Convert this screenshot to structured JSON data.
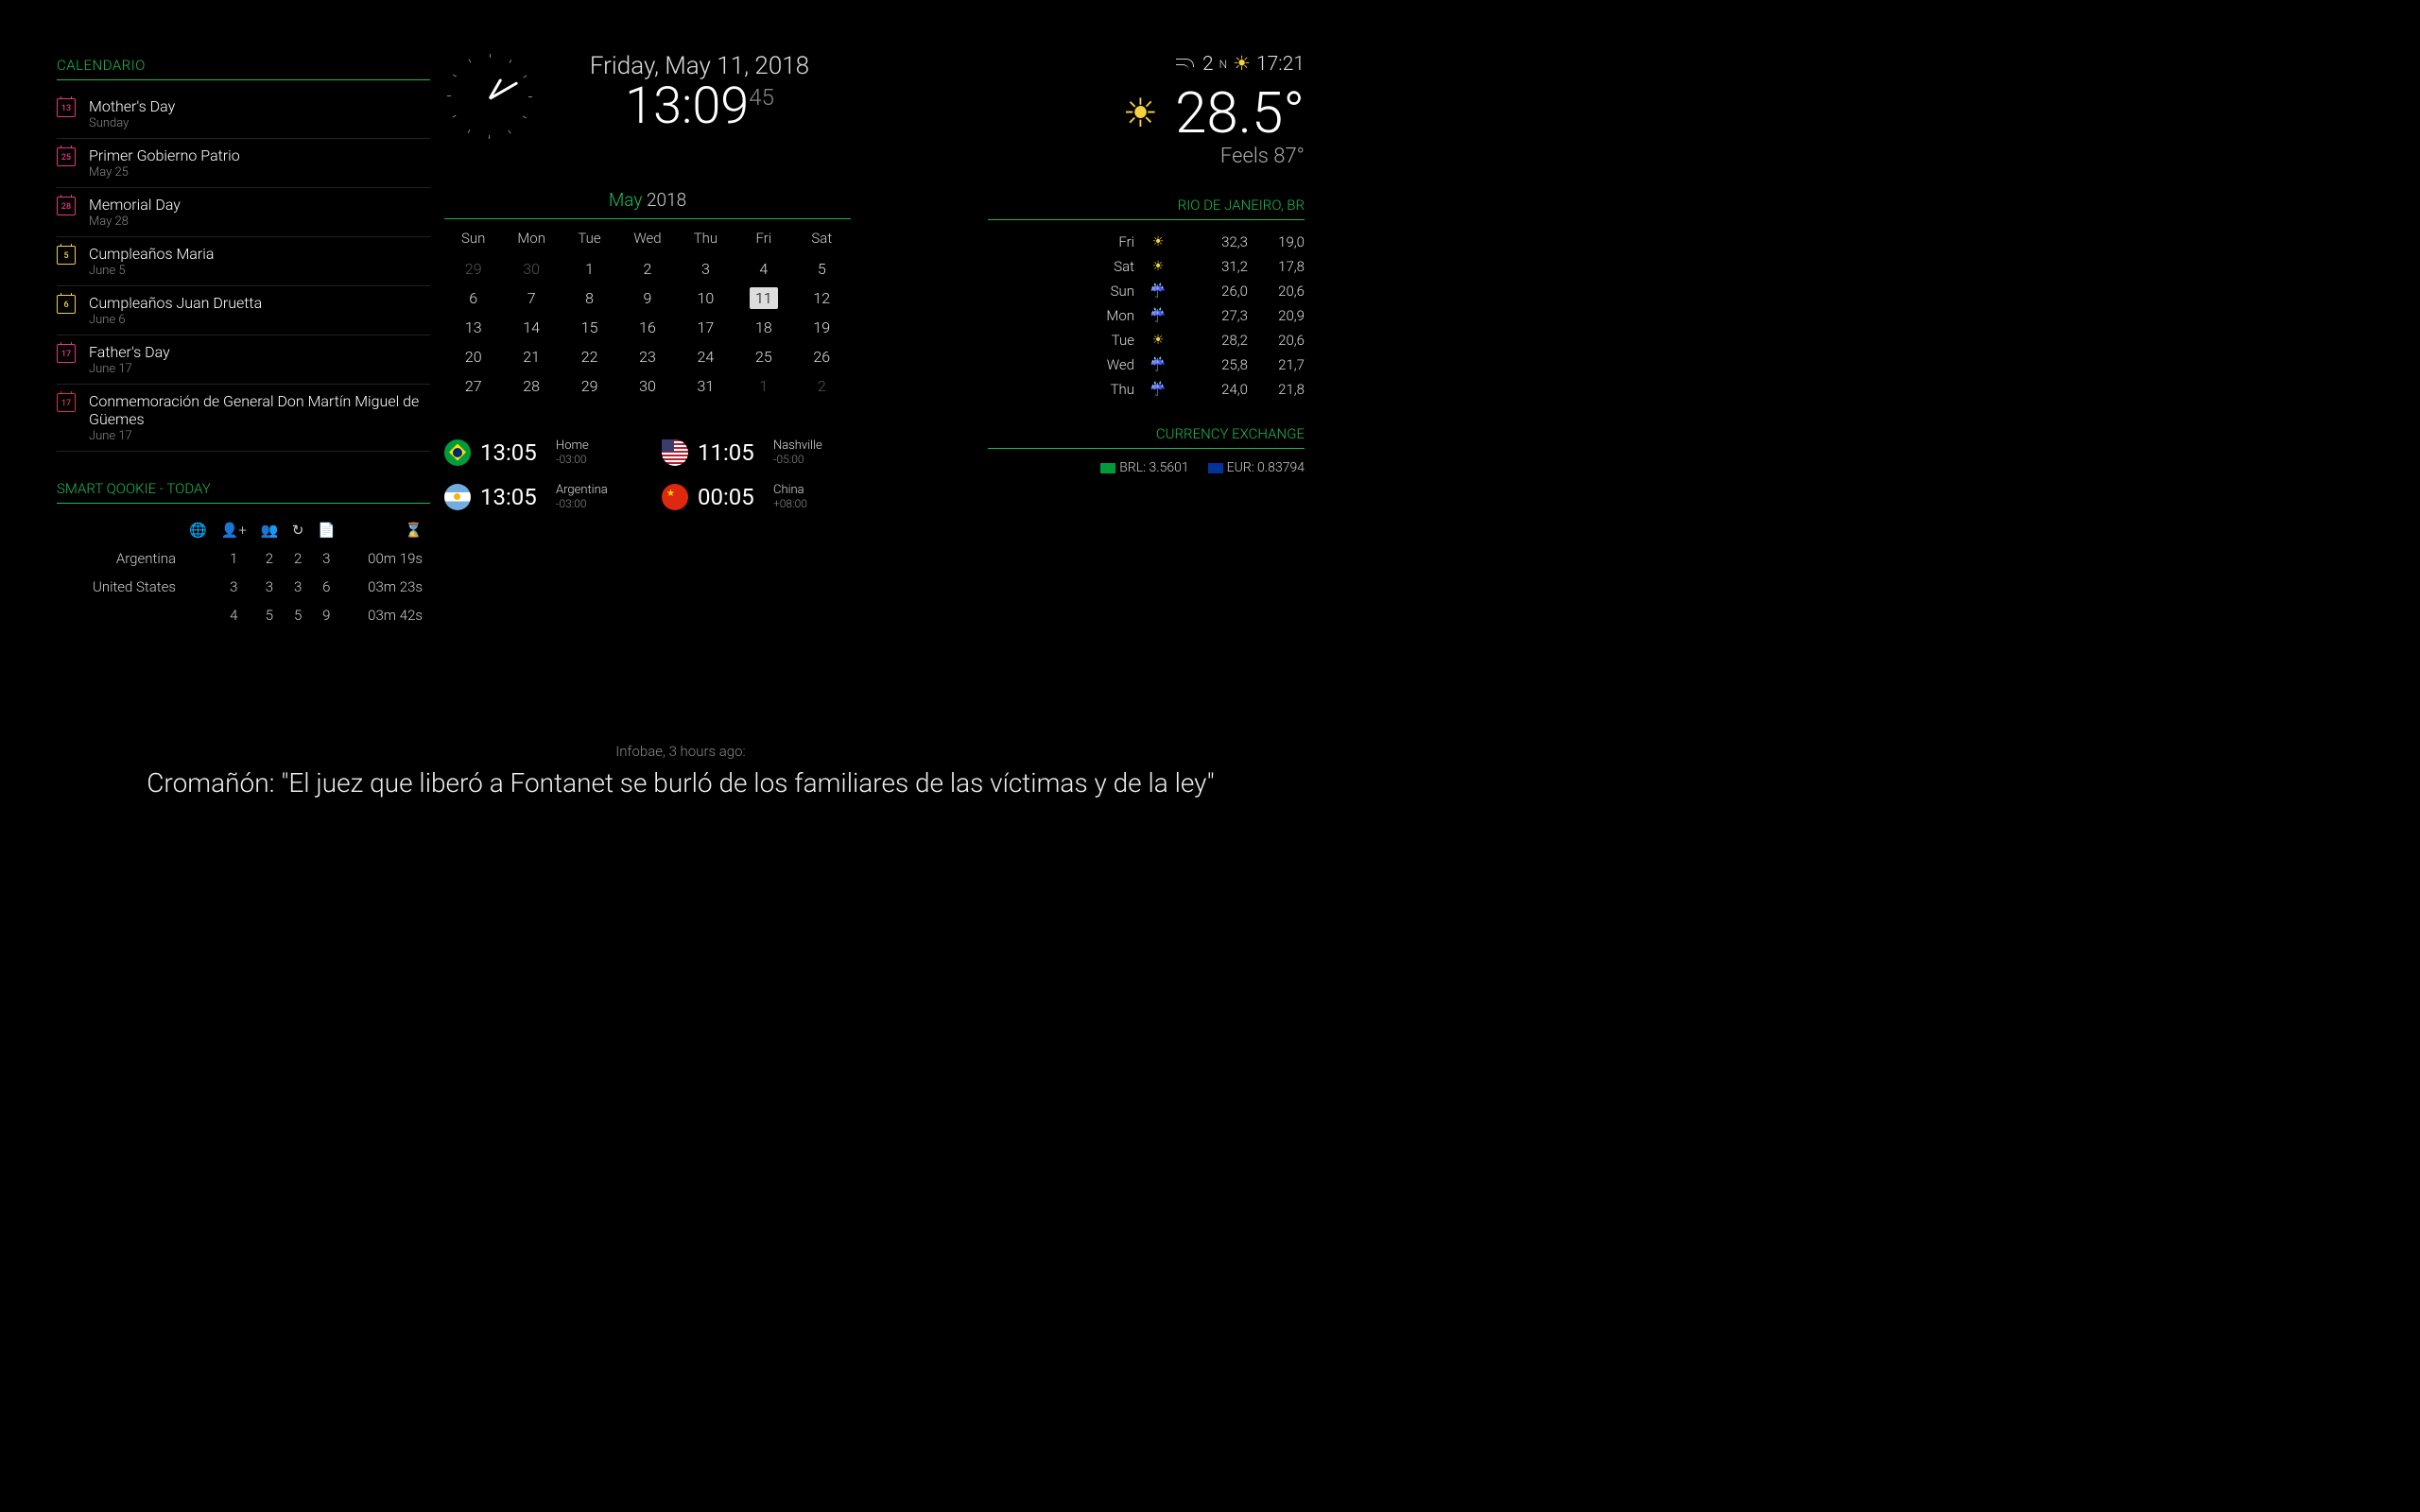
{
  "calendar": {
    "title": "CALENDARIO",
    "events": [
      {
        "day": "13",
        "color": "pink",
        "title": "Mother's Day",
        "sub": "Sunday"
      },
      {
        "day": "25",
        "color": "pink",
        "title": "Primer Gobierno Patrio",
        "sub": "May 25"
      },
      {
        "day": "28",
        "color": "pink",
        "title": "Memorial Day",
        "sub": "May 28"
      },
      {
        "day": "5",
        "color": "yellow",
        "title": "Cumpleaños Maria",
        "sub": "June 5"
      },
      {
        "day": "6",
        "color": "yellow",
        "title": "Cumpleaños Juan Druetta",
        "sub": "June 6"
      },
      {
        "day": "17",
        "color": "pink",
        "title": "Father's Day",
        "sub": "June 17"
      },
      {
        "day": "17",
        "color": "red",
        "title": "Conmemoración de General Don Martín Miguel de Güemes",
        "sub": "June 17"
      }
    ]
  },
  "smart": {
    "title": "SMART QOOKIE - TODAY",
    "rows": [
      {
        "label": "Argentina",
        "c1": "1",
        "c2": "2",
        "c3": "2",
        "c4": "3",
        "dur": "00m 19s"
      },
      {
        "label": "United States",
        "c1": "3",
        "c2": "3",
        "c3": "3",
        "c4": "6",
        "dur": "03m 23s"
      },
      {
        "label": "",
        "c1": "4",
        "c2": "5",
        "c3": "5",
        "c4": "9",
        "dur": "03m 42s"
      }
    ]
  },
  "clock": {
    "date": "Friday, May 11, 2018",
    "time": "13:09",
    "sec": "45"
  },
  "calgrid": {
    "month": "May",
    "year": "2018",
    "dows": [
      "Sun",
      "Mon",
      "Tue",
      "Wed",
      "Thu",
      "Fri",
      "Sat"
    ],
    "cells": [
      {
        "n": "29",
        "off": true
      },
      {
        "n": "30",
        "off": true
      },
      {
        "n": "1"
      },
      {
        "n": "2"
      },
      {
        "n": "3"
      },
      {
        "n": "4"
      },
      {
        "n": "5"
      },
      {
        "n": "6"
      },
      {
        "n": "7"
      },
      {
        "n": "8"
      },
      {
        "n": "9"
      },
      {
        "n": "10"
      },
      {
        "n": "11",
        "today": true
      },
      {
        "n": "12"
      },
      {
        "n": "13"
      },
      {
        "n": "14"
      },
      {
        "n": "15"
      },
      {
        "n": "16"
      },
      {
        "n": "17"
      },
      {
        "n": "18"
      },
      {
        "n": "19"
      },
      {
        "n": "20"
      },
      {
        "n": "21"
      },
      {
        "n": "22"
      },
      {
        "n": "23"
      },
      {
        "n": "24"
      },
      {
        "n": "25"
      },
      {
        "n": "26"
      },
      {
        "n": "27"
      },
      {
        "n": "28"
      },
      {
        "n": "29"
      },
      {
        "n": "30"
      },
      {
        "n": "31"
      },
      {
        "n": "1",
        "off": true
      },
      {
        "n": "2",
        "off": true
      }
    ]
  },
  "worldclock": [
    {
      "flag": "br",
      "time": "13:05",
      "name": "Home",
      "off": "-03:00"
    },
    {
      "flag": "us",
      "time": "11:05",
      "name": "Nashville",
      "off": "-05:00"
    },
    {
      "flag": "ar",
      "time": "13:05",
      "name": "Argentina",
      "off": "-03:00"
    },
    {
      "flag": "cn",
      "time": "00:05",
      "name": "China",
      "off": "+08:00"
    }
  ],
  "weather": {
    "wind": "2",
    "winddir": "N",
    "sunset": "17:21",
    "temp": "28.5°",
    "feels": "Feels 87°",
    "location": "RIO DE JANEIRO, BR",
    "forecast": [
      {
        "day": "Fri",
        "icon": "sun",
        "hi": "32,3",
        "lo": "19,0"
      },
      {
        "day": "Sat",
        "icon": "sun",
        "hi": "31,2",
        "lo": "17,8"
      },
      {
        "day": "Sun",
        "icon": "rain",
        "hi": "26,0",
        "lo": "20,6"
      },
      {
        "day": "Mon",
        "icon": "rain",
        "hi": "27,3",
        "lo": "20,9"
      },
      {
        "day": "Tue",
        "icon": "sun",
        "hi": "28,2",
        "lo": "20,6"
      },
      {
        "day": "Wed",
        "icon": "rain",
        "hi": "25,8",
        "lo": "21,7"
      },
      {
        "day": "Thu",
        "icon": "rain",
        "hi": "24,0",
        "lo": "21,8"
      }
    ]
  },
  "currency": {
    "title": "CURRENCY EXCHANGE",
    "items": [
      {
        "flag": "br",
        "text": "BRL: 3.5601"
      },
      {
        "flag": "eu",
        "text": "EUR: 0.83794"
      }
    ]
  },
  "news": {
    "src": "Infobae, 3 hours ago:",
    "headline": "Cromañón: \"El juez que liberó a Fontanet se burló de los familiares de las víctimas y de la ley\""
  }
}
